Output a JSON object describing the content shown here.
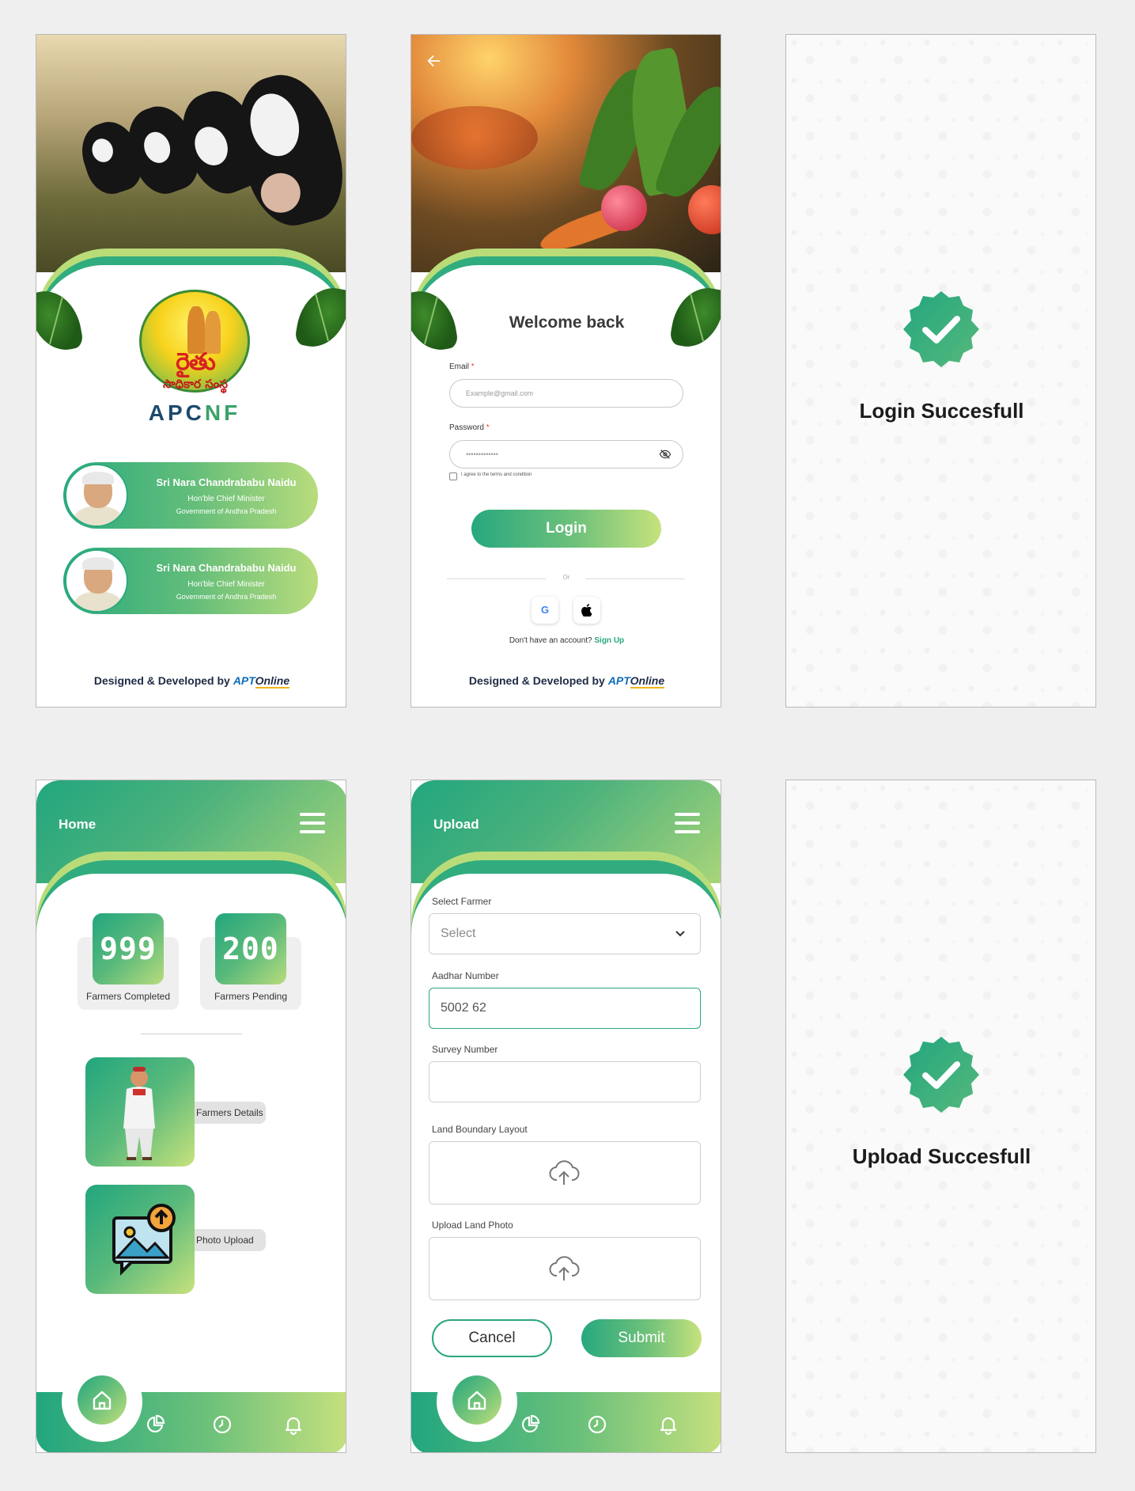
{
  "splash": {
    "logo_telugu_main": "రైతు",
    "logo_telugu_sub": "సాధికార సంస్థ",
    "logo_en_a": "APC",
    "logo_en_b": "NF",
    "cards": [
      {
        "name": "Sri Nara Chandrababu Naidu",
        "role": "Hon'ble Chief Minister",
        "gov": "Government of Andhra Pradesh"
      },
      {
        "name": "Sri Nara Chandrababu Naidu",
        "role": "Hon'ble Chief Minister",
        "gov": "Government of Andhra Pradesh"
      }
    ],
    "footer": "Designed & Developed by",
    "brand_a": "APT",
    "brand_b": "Online"
  },
  "login": {
    "title": "Welcome back",
    "email_label": "Email",
    "email_placeholder": "Example@gmail.com",
    "password_label": "Password",
    "password_value": "•••••••••••••",
    "required_mark": "*",
    "terms": "I agree to the terms and condition",
    "button": "Login",
    "or": "Or",
    "google": "G",
    "apple": "",
    "no_account": "Don't have an account?",
    "signup": "Sign Up",
    "footer": "Designed & Developed by",
    "brand_a": "APT",
    "brand_b": "Online"
  },
  "login_success": {
    "message": "Login Succesfull"
  },
  "home": {
    "title": "Home",
    "stats": [
      {
        "value": "999",
        "label": "Farmers Completed"
      },
      {
        "value": "200",
        "label": "Farmers Pending"
      }
    ],
    "actions": [
      {
        "label": "Farmers Details"
      },
      {
        "label": "Photo Upload"
      }
    ]
  },
  "upload": {
    "title": "Upload",
    "select_farmer_label": "Select Farmer",
    "select_placeholder": "Select",
    "aadhar_label": "Aadhar Number",
    "aadhar_value": "5002 62",
    "survey_label": "Survey Number",
    "survey_value": "",
    "boundary_label": "Land Boundary Layout",
    "photo_label": "Upload Land Photo",
    "cancel": "Cancel",
    "submit": "Submit"
  },
  "upload_success": {
    "message": "Upload Succesfull"
  },
  "nav": {
    "items": [
      "home-icon",
      "chart-icon",
      "clock-icon",
      "bell-icon"
    ]
  },
  "colors": {
    "green_dark": "#22a67e",
    "green_light": "#c5e07e",
    "accent": "#2aa77e"
  }
}
